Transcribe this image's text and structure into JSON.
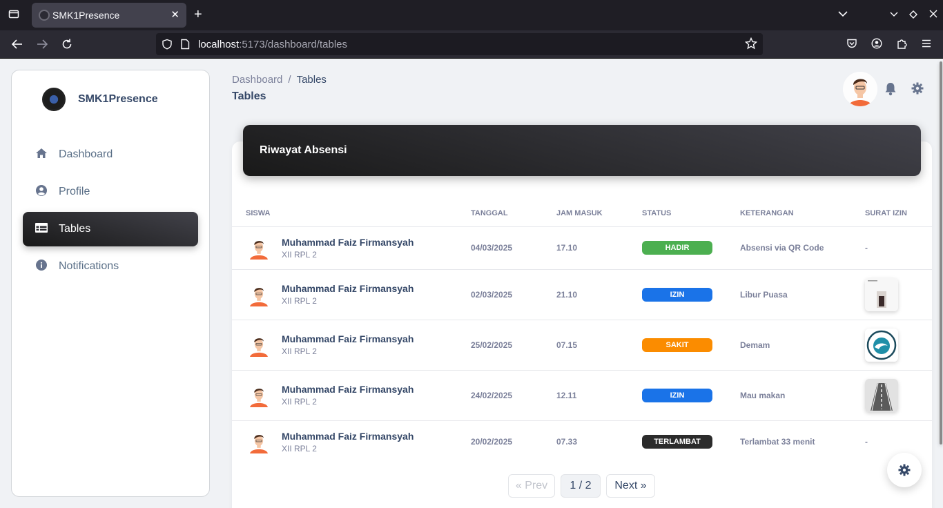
{
  "browser": {
    "tab_title": "SMK1Presence",
    "url_host": "localhost",
    "url_rest": ":5173/dashboard/tables"
  },
  "sidebar": {
    "brand": "SMK1Presence",
    "items": [
      {
        "label": "Dashboard",
        "icon": "home-icon"
      },
      {
        "label": "Profile",
        "icon": "account-circle-icon"
      },
      {
        "label": "Tables",
        "icon": "table-icon",
        "active": true
      },
      {
        "label": "Notifications",
        "icon": "info-icon"
      }
    ]
  },
  "header": {
    "breadcrumb_root": "Dashboard",
    "breadcrumb_sep": "/",
    "breadcrumb_current": "Tables",
    "title": "Tables"
  },
  "card": {
    "title": "Riwayat Absensi",
    "columns": [
      "SISWA",
      "TANGGAL",
      "JAM MASUK",
      "STATUS",
      "KETERANGAN",
      "SURAT IZIN"
    ],
    "rows": [
      {
        "name": "Muhammad Faiz Firmansyah",
        "class": "XII RPL 2",
        "date": "04/03/2025",
        "time": "17.10",
        "status": "HADIR",
        "status_color": "#4caf50",
        "note": "Absensi via QR Code",
        "letter": "-"
      },
      {
        "name": "Muhammad Faiz Firmansyah",
        "class": "XII RPL 2",
        "date": "02/03/2025",
        "time": "21.10",
        "status": "IZIN",
        "status_color": "#1a73e8",
        "note": "Libur Puasa",
        "letter": "image"
      },
      {
        "name": "Muhammad Faiz Firmansyah",
        "class": "XII RPL 2",
        "date": "25/02/2025",
        "time": "07.15",
        "status": "SAKIT",
        "status_color": "#fb8c00",
        "note": "Demam",
        "letter": "image"
      },
      {
        "name": "Muhammad Faiz Firmansyah",
        "class": "XII RPL 2",
        "date": "24/02/2025",
        "time": "12.11",
        "status": "IZIN",
        "status_color": "#1a73e8",
        "note": "Mau makan",
        "letter": "image"
      },
      {
        "name": "Muhammad Faiz Firmansyah",
        "class": "XII RPL 2",
        "date": "20/02/2025",
        "time": "07.33",
        "status": "TERLAMBAT",
        "status_color": "#2b2b2b",
        "note": "Terlambat 33 menit",
        "letter": "-"
      }
    ]
  },
  "pagination": {
    "prev": "« Prev",
    "current": "1 / 2",
    "next": "Next »"
  }
}
